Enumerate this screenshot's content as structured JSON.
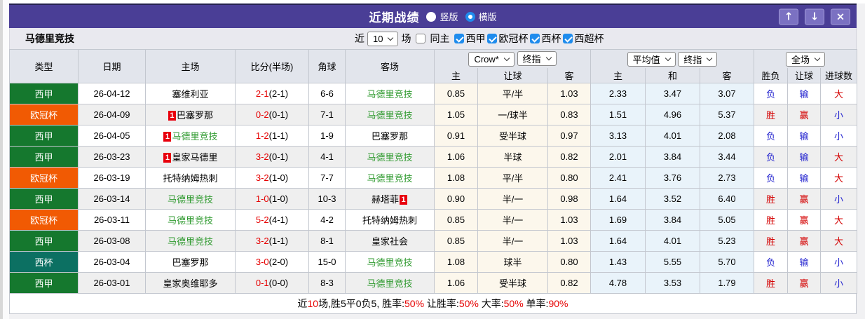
{
  "titlebar": {
    "title": "近期战绩",
    "view_options": [
      {
        "label": "竖版",
        "selected": false
      },
      {
        "label": "横版",
        "selected": true
      }
    ],
    "buttons": [
      {
        "icon": "arrow-up-icon",
        "glyph": "↑"
      },
      {
        "icon": "arrow-down-icon",
        "glyph": "↓"
      },
      {
        "icon": "close-icon",
        "glyph": "×"
      }
    ]
  },
  "filterbar": {
    "team": "马德里竞技",
    "recent_label": "近",
    "recent_value": "10",
    "games_label": "场",
    "same_home_label": "同主",
    "same_home_checked": false,
    "leagues": [
      "西甲",
      "欧冠杯",
      "西杯",
      "西超杯"
    ]
  },
  "table": {
    "columns": {
      "type": "类型",
      "date": "日期",
      "home": "主场",
      "score": "比分(半场)",
      "corner": "角球",
      "away": "客场",
      "odds_home": "主",
      "odds_line": "让球",
      "odds_away": "客",
      "avg_home": "主",
      "avg_draw": "和",
      "avg_away": "客",
      "wdl": "胜负",
      "handicap_result": "让球",
      "goals": "进球数"
    },
    "selects": {
      "company": "Crow*",
      "company_time": "终指",
      "average": "平均值",
      "average_time": "终指",
      "period": "全场"
    },
    "league_colors": {
      "西甲": "#15782e",
      "欧冠杯": "#f15a03",
      "西杯": "#0c7062"
    },
    "rows": [
      {
        "type": "西甲",
        "date": "26-04-12",
        "home": {
          "badge": "",
          "name": "塞维利亚",
          "green": false
        },
        "score": {
          "ft": "2-1",
          "ht": "(2-1)"
        },
        "corner": "6-6",
        "away": {
          "name": "马德里竞技",
          "badge": "",
          "green": true
        },
        "handicap": {
          "home": "0.85",
          "line": "平/半",
          "away": "1.03"
        },
        "average": {
          "home": "2.33",
          "draw": "3.47",
          "away": "3.07"
        },
        "results": [
          {
            "text": "负",
            "color": "blue"
          },
          {
            "text": "输",
            "color": "blue"
          },
          {
            "text": "大",
            "color": "red"
          }
        ]
      },
      {
        "type": "欧冠杯",
        "date": "26-04-09",
        "home": {
          "badge": "1",
          "name": "巴塞罗那",
          "green": false
        },
        "score": {
          "ft": "0-2",
          "ht": "(0-1)"
        },
        "corner": "7-1",
        "away": {
          "name": "马德里竞技",
          "badge": "",
          "green": true
        },
        "handicap": {
          "home": "1.05",
          "line": "一/球半",
          "away": "0.83"
        },
        "average": {
          "home": "1.51",
          "draw": "4.96",
          "away": "5.37"
        },
        "results": [
          {
            "text": "胜",
            "color": "red"
          },
          {
            "text": "赢",
            "color": "red"
          },
          {
            "text": "小",
            "color": "blue"
          }
        ]
      },
      {
        "type": "西甲",
        "date": "26-04-05",
        "home": {
          "badge": "1",
          "name": "马德里竞技",
          "green": true
        },
        "score": {
          "ft": "1-2",
          "ht": "(1-1)"
        },
        "corner": "1-9",
        "away": {
          "name": "巴塞罗那",
          "badge": "",
          "green": false
        },
        "handicap": {
          "home": "0.91",
          "line": "受半球",
          "away": "0.97"
        },
        "average": {
          "home": "3.13",
          "draw": "4.01",
          "away": "2.08"
        },
        "results": [
          {
            "text": "负",
            "color": "blue"
          },
          {
            "text": "输",
            "color": "blue"
          },
          {
            "text": "小",
            "color": "blue"
          }
        ]
      },
      {
        "type": "西甲",
        "date": "26-03-23",
        "home": {
          "badge": "1",
          "name": "皇家马德里",
          "green": false
        },
        "score": {
          "ft": "3-2",
          "ht": "(0-1)"
        },
        "corner": "4-1",
        "away": {
          "name": "马德里竞技",
          "badge": "",
          "green": true
        },
        "handicap": {
          "home": "1.06",
          "line": "半球",
          "away": "0.82"
        },
        "average": {
          "home": "2.01",
          "draw": "3.84",
          "away": "3.44"
        },
        "results": [
          {
            "text": "负",
            "color": "blue"
          },
          {
            "text": "输",
            "color": "blue"
          },
          {
            "text": "大",
            "color": "red"
          }
        ]
      },
      {
        "type": "欧冠杯",
        "date": "26-03-19",
        "home": {
          "badge": "",
          "name": "托特纳姆热刺",
          "green": false
        },
        "score": {
          "ft": "3-2",
          "ht": "(1-0)"
        },
        "corner": "7-7",
        "away": {
          "name": "马德里竞技",
          "badge": "",
          "green": true
        },
        "handicap": {
          "home": "1.08",
          "line": "平/半",
          "away": "0.80"
        },
        "average": {
          "home": "2.41",
          "draw": "3.76",
          "away": "2.73"
        },
        "results": [
          {
            "text": "负",
            "color": "blue"
          },
          {
            "text": "输",
            "color": "blue"
          },
          {
            "text": "大",
            "color": "red"
          }
        ]
      },
      {
        "type": "西甲",
        "date": "26-03-14",
        "home": {
          "badge": "",
          "name": "马德里竞技",
          "green": true
        },
        "score": {
          "ft": "1-0",
          "ht": "(1-0)"
        },
        "corner": "10-3",
        "away": {
          "name": "赫塔菲",
          "badge": "1",
          "green": false
        },
        "handicap": {
          "home": "0.90",
          "line": "半/一",
          "away": "0.98"
        },
        "average": {
          "home": "1.64",
          "draw": "3.52",
          "away": "6.40"
        },
        "results": [
          {
            "text": "胜",
            "color": "red"
          },
          {
            "text": "赢",
            "color": "red"
          },
          {
            "text": "小",
            "color": "blue"
          }
        ]
      },
      {
        "type": "欧冠杯",
        "date": "26-03-11",
        "home": {
          "badge": "",
          "name": "马德里竞技",
          "green": true
        },
        "score": {
          "ft": "5-2",
          "ht": "(4-1)"
        },
        "corner": "4-2",
        "away": {
          "name": "托特纳姆热刺",
          "badge": "",
          "green": false
        },
        "handicap": {
          "home": "0.85",
          "line": "半/一",
          "away": "1.03"
        },
        "average": {
          "home": "1.69",
          "draw": "3.84",
          "away": "5.05"
        },
        "results": [
          {
            "text": "胜",
            "color": "red"
          },
          {
            "text": "赢",
            "color": "red"
          },
          {
            "text": "大",
            "color": "red"
          }
        ]
      },
      {
        "type": "西甲",
        "date": "26-03-08",
        "home": {
          "badge": "",
          "name": "马德里竞技",
          "green": true
        },
        "score": {
          "ft": "3-2",
          "ht": "(1-1)"
        },
        "corner": "8-1",
        "away": {
          "name": "皇家社会",
          "badge": "",
          "green": false
        },
        "handicap": {
          "home": "0.85",
          "line": "半/一",
          "away": "1.03"
        },
        "average": {
          "home": "1.64",
          "draw": "4.01",
          "away": "5.23"
        },
        "results": [
          {
            "text": "胜",
            "color": "red"
          },
          {
            "text": "赢",
            "color": "red"
          },
          {
            "text": "大",
            "color": "red"
          }
        ]
      },
      {
        "type": "西杯",
        "date": "26-03-04",
        "home": {
          "badge": "",
          "name": "巴塞罗那",
          "green": false
        },
        "score": {
          "ft": "3-0",
          "ht": "(2-0)"
        },
        "corner": "15-0",
        "away": {
          "name": "马德里竞技",
          "badge": "",
          "green": true
        },
        "handicap": {
          "home": "1.08",
          "line": "球半",
          "away": "0.80"
        },
        "average": {
          "home": "1.43",
          "draw": "5.55",
          "away": "5.70"
        },
        "results": [
          {
            "text": "负",
            "color": "blue"
          },
          {
            "text": "输",
            "color": "blue"
          },
          {
            "text": "小",
            "color": "blue"
          }
        ]
      },
      {
        "type": "西甲",
        "date": "26-03-01",
        "home": {
          "badge": "",
          "name": "皇家奥维耶多",
          "green": false
        },
        "score": {
          "ft": "0-1",
          "ht": "(0-0)"
        },
        "corner": "8-3",
        "away": {
          "name": "马德里竞技",
          "badge": "",
          "green": true
        },
        "handicap": {
          "home": "1.06",
          "line": "受半球",
          "away": "0.82"
        },
        "average": {
          "home": "4.78",
          "draw": "3.53",
          "away": "1.79"
        },
        "results": [
          {
            "text": "胜",
            "color": "red"
          },
          {
            "text": "赢",
            "color": "red"
          },
          {
            "text": "小",
            "color": "blue"
          }
        ]
      }
    ]
  },
  "footer": {
    "segments": [
      {
        "text": "近",
        "color": "#000000"
      },
      {
        "text": "10",
        "color": "#e60000"
      },
      {
        "text": "场,胜5平0负5, 胜率:",
        "color": "#000000"
      },
      {
        "text": "50%",
        "color": "#e60000"
      },
      {
        "text": " 让胜率:",
        "color": "#000000"
      },
      {
        "text": "50%",
        "color": "#e60000"
      },
      {
        "text": " 大率:",
        "color": "#000000"
      },
      {
        "text": "50%",
        "color": "#e60000"
      },
      {
        "text": " 单率:",
        "color": "#000000"
      },
      {
        "text": "90%",
        "color": "#e60000"
      }
    ]
  },
  "palette": {
    "header_purple": "#4a3e96",
    "check_blue": "#1f8ced",
    "team_green": "#2f9a2f",
    "score_red": "#e60000",
    "win_red": "#d40000",
    "lose_blue": "#2323cf",
    "badge_red": "#e8000d"
  }
}
